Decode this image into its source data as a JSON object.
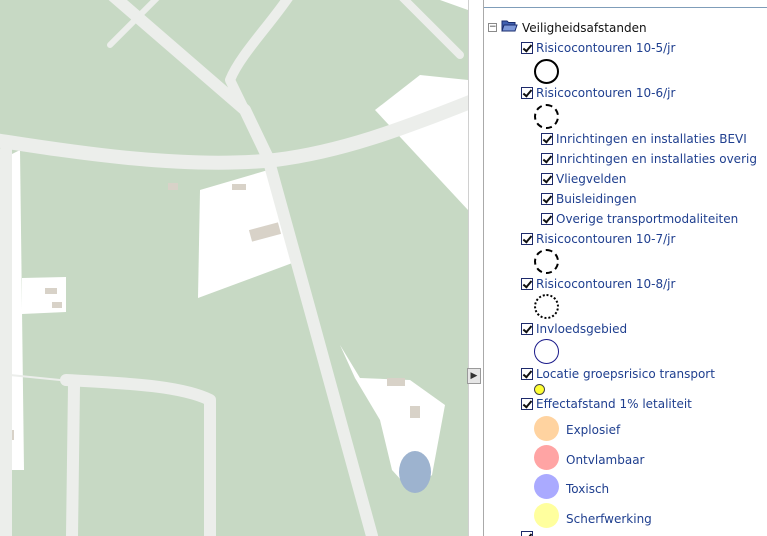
{
  "legend": {
    "root": {
      "label": "Veiligheidsafstanden",
      "icon": "folder-icon",
      "expanded": true
    },
    "layers": [
      {
        "label": "Risicocontouren 10-5/jr",
        "checked": true,
        "symbol": "solid-circle"
      },
      {
        "label": "Risicocontouren 10-6/jr",
        "checked": true,
        "symbol": "dashed-circle"
      },
      {
        "label": "Inrichtingen en installaties BEVI",
        "checked": true
      },
      {
        "label": "Inrichtingen en installaties overig",
        "checked": true
      },
      {
        "label": "Vliegvelden",
        "checked": true
      },
      {
        "label": "Buisleidingen",
        "checked": true
      },
      {
        "label": "Overige transportmodaliteiten",
        "checked": true
      },
      {
        "label": "Risicocontouren 10-7/jr",
        "checked": true,
        "symbol": "dashed-circle"
      },
      {
        "label": "Risicocontouren 10-8/jr",
        "checked": true,
        "symbol": "dotted-circle"
      },
      {
        "label": "Invloedsgebied",
        "checked": true,
        "symbol": "blue-circle"
      },
      {
        "label": "Locatie groepsrisico transport",
        "checked": true,
        "symbol": "yellow-dot"
      },
      {
        "label": "Effectafstand 1% letaliteit",
        "checked": true
      }
    ],
    "effect_classes": [
      {
        "label": "Explosief",
        "color": "#ffd3a0"
      },
      {
        "label": "Ontvlambaar",
        "color": "#ffa4a4"
      },
      {
        "label": "Toxisch",
        "color": "#aaaaff"
      },
      {
        "label": "Scherfwerking",
        "color": "#ffff9e"
      }
    ]
  },
  "colors": {
    "map_background": "#c7d9c4",
    "road": "#e8ede7",
    "clearing": "#ffffff",
    "water": "#9db3cf",
    "link_text": "#1f3f8f"
  }
}
